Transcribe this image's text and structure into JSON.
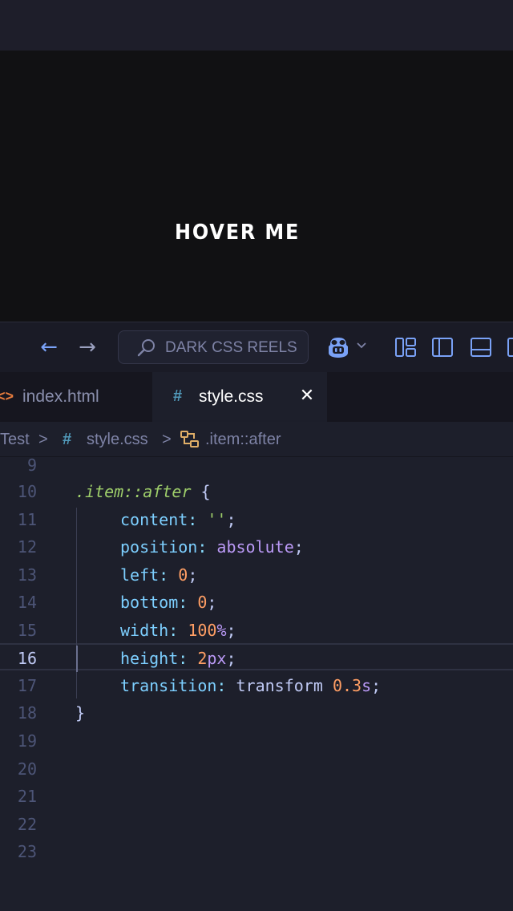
{
  "preview": {
    "hover_text": "HOVER ME"
  },
  "titlebar": {
    "search_label": "DARK CSS REELS"
  },
  "tabs": [
    {
      "icon": "<>",
      "label": "index.html"
    },
    {
      "icon": "#",
      "label": "style.css",
      "close": "✕"
    }
  ],
  "breadcrumb": {
    "folder": "Test",
    "file_icon": "#",
    "file": "style.css",
    "symbol": ".item::after",
    "sep": ">"
  },
  "editor": {
    "line_numbers": [
      "9",
      "10",
      "11",
      "12",
      "13",
      "14",
      "15",
      "16",
      "17",
      "18",
      "19",
      "20",
      "21",
      "22",
      "23"
    ],
    "line10": {
      "selector": ".item::after",
      "brace": " {"
    },
    "line11": {
      "prop": "content",
      "colon": ": ",
      "value": "''",
      "semi": ";"
    },
    "line12": {
      "prop": "position",
      "colon": ": ",
      "value": "absolute",
      "semi": ";"
    },
    "line13": {
      "prop": "left",
      "colon": ": ",
      "value": "0",
      "semi": ";"
    },
    "line14": {
      "prop": "bottom",
      "colon": ": ",
      "value": "0",
      "semi": ";"
    },
    "line15": {
      "prop": "width",
      "colon": ": ",
      "value": "100",
      "unit": "%",
      "semi": ";"
    },
    "line16": {
      "prop": "height",
      "colon": ": ",
      "value": "2",
      "unit": "px",
      "semi": ";"
    },
    "line17": {
      "prop": "transition",
      "colon": ": ",
      "value": "transform ",
      "num": "0.3",
      "unit": "s",
      "semi": ";"
    },
    "line18": {
      "brace": "}"
    }
  },
  "colors": {
    "background": "#1d1f2b",
    "preview_bg": "#111113",
    "selector": "#9ece6a",
    "property": "#7dcfff",
    "keyword": "#bb9af7",
    "number": "#ff9e64"
  }
}
